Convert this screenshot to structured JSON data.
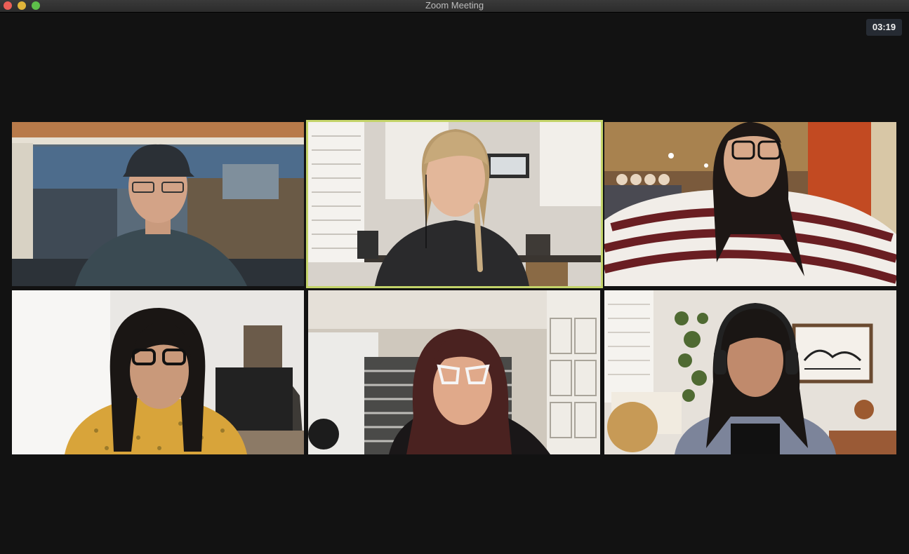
{
  "window": {
    "title": "Zoom Meeting",
    "controls": [
      "close",
      "minimize",
      "maximize"
    ]
  },
  "meeting": {
    "timer": "03:19",
    "active_speaker_color": "#c4d46a",
    "participants": [
      {
        "tile": 1,
        "active_speaker": false
      },
      {
        "tile": 2,
        "active_speaker": true
      },
      {
        "tile": 3,
        "active_speaker": false
      },
      {
        "tile": 4,
        "active_speaker": false
      },
      {
        "tile": 5,
        "active_speaker": false
      },
      {
        "tile": 6,
        "active_speaker": false
      }
    ]
  }
}
